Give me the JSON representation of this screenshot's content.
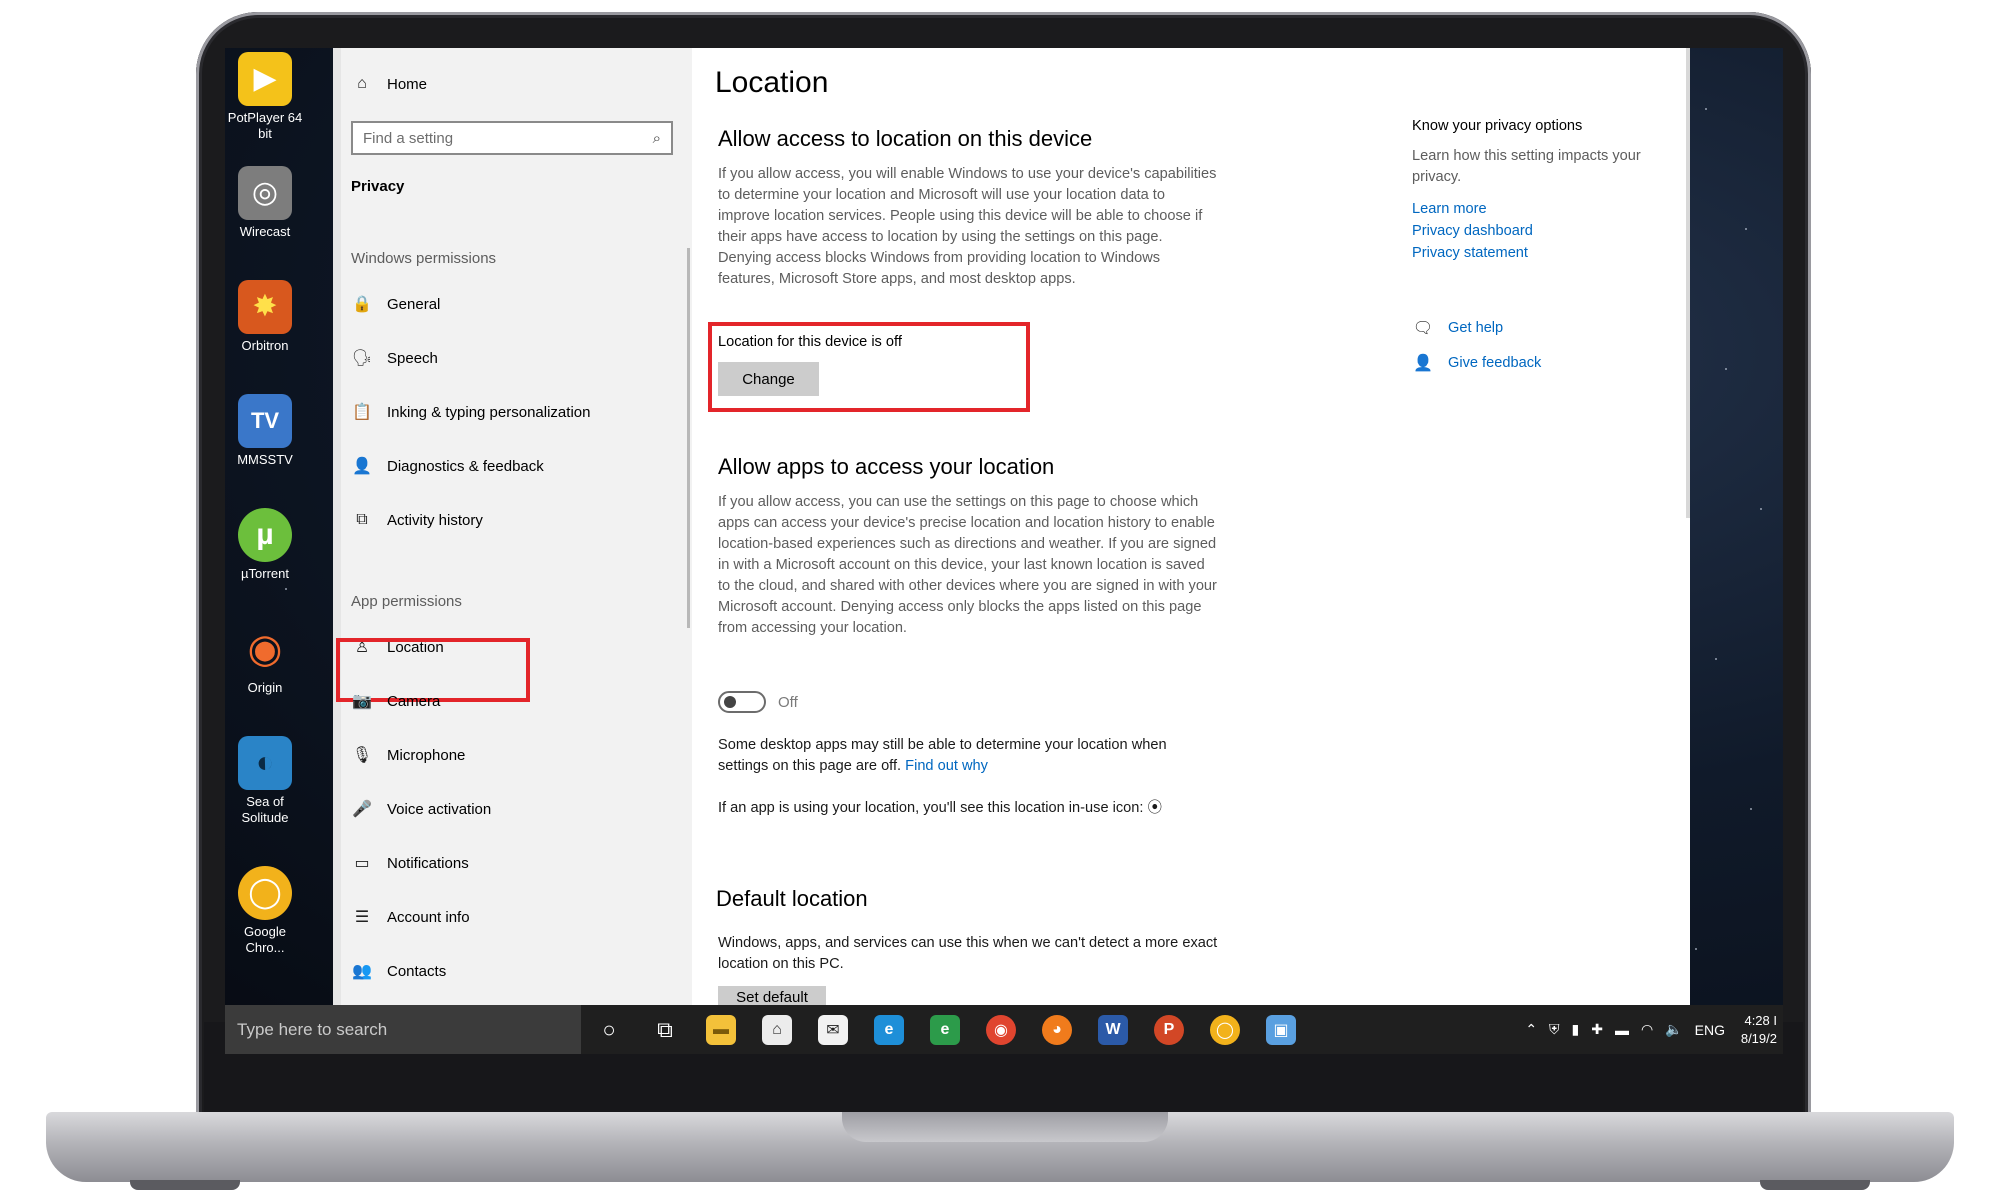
{
  "desktop": {
    "icons": [
      {
        "label": "PotPlayer 64 bit",
        "glyph": "▶",
        "color": "#f4c21a"
      },
      {
        "label": "Wirecast",
        "glyph": "◎",
        "color": "#8d8d8d"
      },
      {
        "label": "Orbitron",
        "glyph": "✸",
        "color": "#e8742a"
      },
      {
        "label": "MMSSTV",
        "glyph": "TV",
        "color": "#3a77c9"
      },
      {
        "label": "µTorrent",
        "glyph": "µ",
        "color": "#6cbf3c"
      },
      {
        "label": "Origin",
        "glyph": "◉",
        "color": "#f06b2d"
      },
      {
        "label": "Sea of Solitude",
        "glyph": "◐",
        "color": "#2a84c7"
      },
      {
        "label": "Google Chro...",
        "glyph": "◯",
        "color": "#f2b21b"
      }
    ]
  },
  "sidebar": {
    "home": "Home",
    "search_placeholder": "Find a setting",
    "section": "Privacy",
    "windows_permissions_heading": "Windows permissions",
    "windows_permissions": [
      {
        "label": "General",
        "icon": "lock-icon",
        "glyph": "🔒"
      },
      {
        "label": "Speech",
        "icon": "speech-icon",
        "glyph": "🗣"
      },
      {
        "label": "Inking & typing personalization",
        "icon": "clipboard-icon",
        "glyph": "📋"
      },
      {
        "label": "Diagnostics & feedback",
        "icon": "feedback-person-icon",
        "glyph": "👤"
      },
      {
        "label": "Activity history",
        "icon": "timeline-icon",
        "glyph": "⧉"
      }
    ],
    "app_permissions_heading": "App permissions",
    "app_permissions": [
      {
        "label": "Location",
        "icon": "location-person-icon",
        "glyph": "♙"
      },
      {
        "label": "Camera",
        "icon": "camera-icon",
        "glyph": "📷"
      },
      {
        "label": "Microphone",
        "icon": "microphone-icon",
        "glyph": "🎙"
      },
      {
        "label": "Voice activation",
        "icon": "voice-icon",
        "glyph": "🎤"
      },
      {
        "label": "Notifications",
        "icon": "notification-icon",
        "glyph": "▭"
      },
      {
        "label": "Account info",
        "icon": "account-info-icon",
        "glyph": "☰"
      },
      {
        "label": "Contacts",
        "icon": "contacts-icon",
        "glyph": "👥"
      }
    ]
  },
  "content": {
    "title": "Location",
    "device_heading": "Allow access to location on this device",
    "device_text": "If you allow access, you will enable Windows to use your device's capabilities to determine your location and Microsoft will use your location data to improve location services. People using this device will be able to choose if their apps have access to location by using the settings on this page. Denying access blocks Windows from providing location to Windows features, Microsoft Store apps, and most desktop apps.",
    "device_status": "Location for this device is off",
    "change_button": "Change",
    "apps_heading": "Allow apps to access your location",
    "apps_text": "If you allow access, you can use the settings on this page to choose which apps can access your device's precise location and location history to enable location-based experiences such as directions and weather. If you are signed in with a Microsoft account on this device, your last known location is saved to the cloud, and shared with other devices where you are signed in with your Microsoft account. Denying access only blocks the apps listed on this page from accessing your location.",
    "toggle_label": "Off",
    "desktop_apps_text": "Some desktop apps may still be able to determine your location when settings on this page are off.",
    "find_out_why": "Find out why",
    "in_use_text": "If an app is using your location, you'll see this location in-use icon:",
    "default_heading": "Default location",
    "default_text": "Windows, apps, and services can use this when we can't detect a more exact location on this PC.",
    "set_default_button": "Set default"
  },
  "side_panel": {
    "heading": "Know your privacy options",
    "subtext": "Learn how this setting impacts your privacy.",
    "links": [
      "Learn more",
      "Privacy dashboard",
      "Privacy statement"
    ],
    "get_help": "Get help",
    "give_feedback": "Give feedback"
  },
  "taskbar": {
    "search_placeholder": "Type here to search",
    "apps": [
      {
        "name": "file-explorer",
        "glyph": "▬",
        "color": "#f3c13a"
      },
      {
        "name": "store",
        "glyph": "⌂",
        "color": "#dcdcdc"
      },
      {
        "name": "mail",
        "glyph": "✉",
        "color": "#e9e9e9"
      },
      {
        "name": "internet-explorer",
        "glyph": "e",
        "color": "#1e8fd8"
      },
      {
        "name": "xbox-edge",
        "glyph": "e",
        "color": "#2c9b4a"
      },
      {
        "name": "chrome",
        "glyph": "◉",
        "color": "#e0452f"
      },
      {
        "name": "firefox",
        "glyph": "◕",
        "color": "#f07b1c"
      },
      {
        "name": "word",
        "glyph": "W",
        "color": "#2b5aa8"
      },
      {
        "name": "powerpoint",
        "glyph": "P",
        "color": "#d24726"
      },
      {
        "name": "chrome-canary",
        "glyph": "◯",
        "color": "#f2b21b"
      },
      {
        "name": "remote-desktop",
        "glyph": "▣",
        "color": "#5aa0e0"
      }
    ],
    "language": "ENG",
    "time": "4:28 I",
    "date": "8/19/2"
  }
}
